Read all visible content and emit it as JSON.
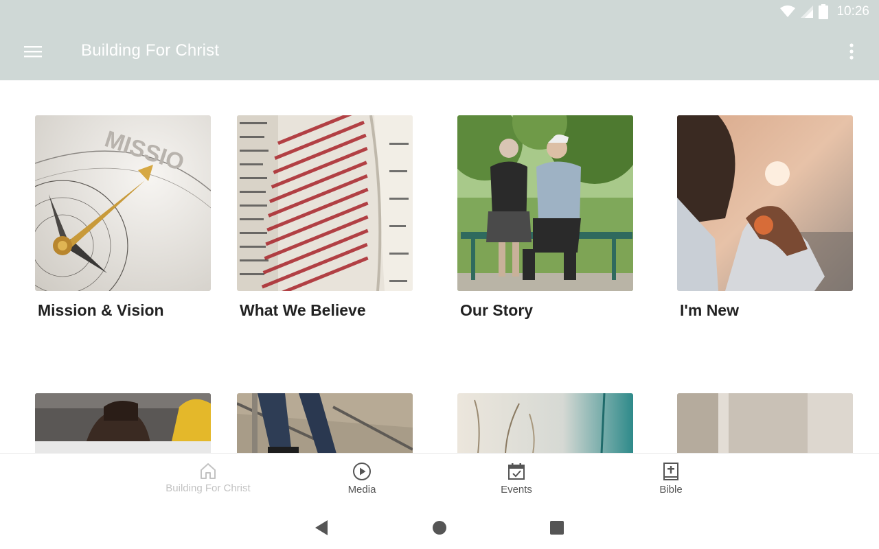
{
  "status_bar": {
    "time": "10:26"
  },
  "app_bar": {
    "title": "Building For Christ",
    "menu_icon": "hamburger-menu-icon",
    "more_icon": "more-vert-icon"
  },
  "tiles": [
    {
      "caption": "Mission & Vision"
    },
    {
      "caption": "What We Believe"
    },
    {
      "caption": "Our Story"
    },
    {
      "caption": "I'm New"
    }
  ],
  "bottom_nav": {
    "active_color": "#c2c2c2",
    "items": [
      {
        "label": "Building For Christ",
        "icon": "home-icon"
      },
      {
        "label": "Media",
        "icon": "play-circle-icon"
      },
      {
        "label": "Events",
        "icon": "calendar-check-icon"
      },
      {
        "label": "Bible",
        "icon": "bible-cross-icon"
      }
    ]
  },
  "colors": {
    "header": "#cfd8d6",
    "caption": "#222222",
    "nav_text": "#555555"
  }
}
